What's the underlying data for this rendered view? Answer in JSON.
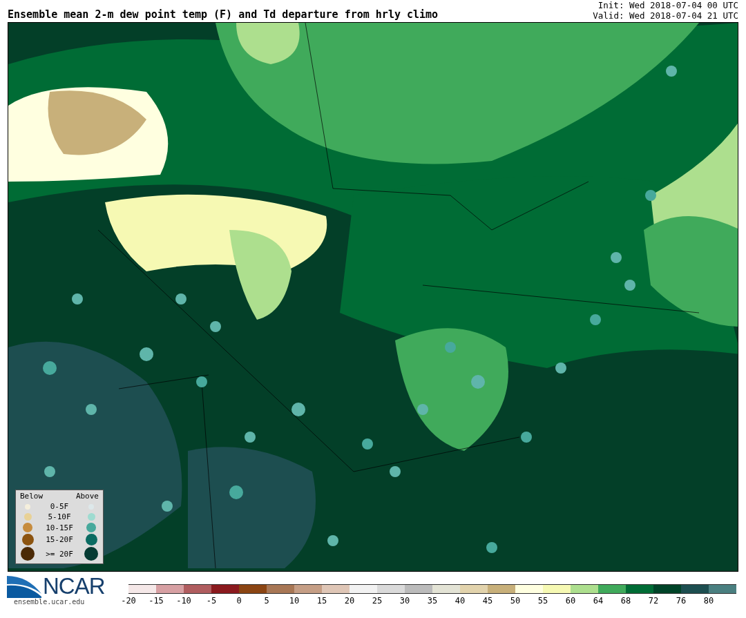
{
  "title": "Ensemble mean 2-m dew point temp (F) and Td departure from hrly climo",
  "init": "Init: Wed 2018-07-04 00 UTC",
  "valid": "Valid: Wed 2018-07-04 21 UTC",
  "legend": {
    "below_label": "Below",
    "above_label": "Above",
    "rows": [
      {
        "label": "0-5F",
        "below": {
          "color": "#f5efdc"
        },
        "above": {
          "color": "#dde8ea"
        }
      },
      {
        "label": "5-10F",
        "below": {
          "color": "#e8d196"
        },
        "above": {
          "color": "#9edbd0"
        }
      },
      {
        "label": "10-15F",
        "below": {
          "color": "#c68c3e"
        },
        "above": {
          "color": "#47a99c"
        }
      },
      {
        "label": "15-20F",
        "below": {
          "color": "#8c5410"
        },
        "above": {
          "color": "#0b6b62"
        }
      },
      {
        "label": ">= 20F",
        "below": {
          "color": "#4b2a06"
        },
        "above": {
          "color": "#053b33"
        }
      }
    ]
  },
  "logo": {
    "text": "NCAR",
    "url": "ensemble.ucar.edu"
  },
  "colorbar": [
    {
      "tick": "-20",
      "color": "#f5e8e8"
    },
    {
      "tick": "-15",
      "color": "#d7a0a3"
    },
    {
      "tick": "-10",
      "color": "#b05d5f"
    },
    {
      "tick": "-5",
      "color": "#8b1a1e"
    },
    {
      "tick": "0",
      "color": "#8b4513"
    },
    {
      "tick": "5",
      "color": "#a87755"
    },
    {
      "tick": "10",
      "color": "#c59e85"
    },
    {
      "tick": "15",
      "color": "#dfc6b6"
    },
    {
      "tick": "20",
      "color": "#f2f2f2"
    },
    {
      "tick": "25",
      "color": "#dadada"
    },
    {
      "tick": "30",
      "color": "#bbbbbb"
    },
    {
      "tick": "35",
      "color": "#e3e3d5"
    },
    {
      "tick": "40",
      "color": "#e2d3ac"
    },
    {
      "tick": "45",
      "color": "#c8b07a"
    },
    {
      "tick": "50",
      "color": "#ffffe0"
    },
    {
      "tick": "55",
      "color": "#f6f9b3"
    },
    {
      "tick": "60",
      "color": "#addf8e"
    },
    {
      "tick": "64",
      "color": "#40aa5b"
    },
    {
      "tick": "68",
      "color": "#006c35"
    },
    {
      "tick": "72",
      "color": "#004428"
    },
    {
      "tick": "76",
      "color": "#1d4e50"
    },
    {
      "tick": "80",
      "color": "#4a7f80"
    }
  ]
}
